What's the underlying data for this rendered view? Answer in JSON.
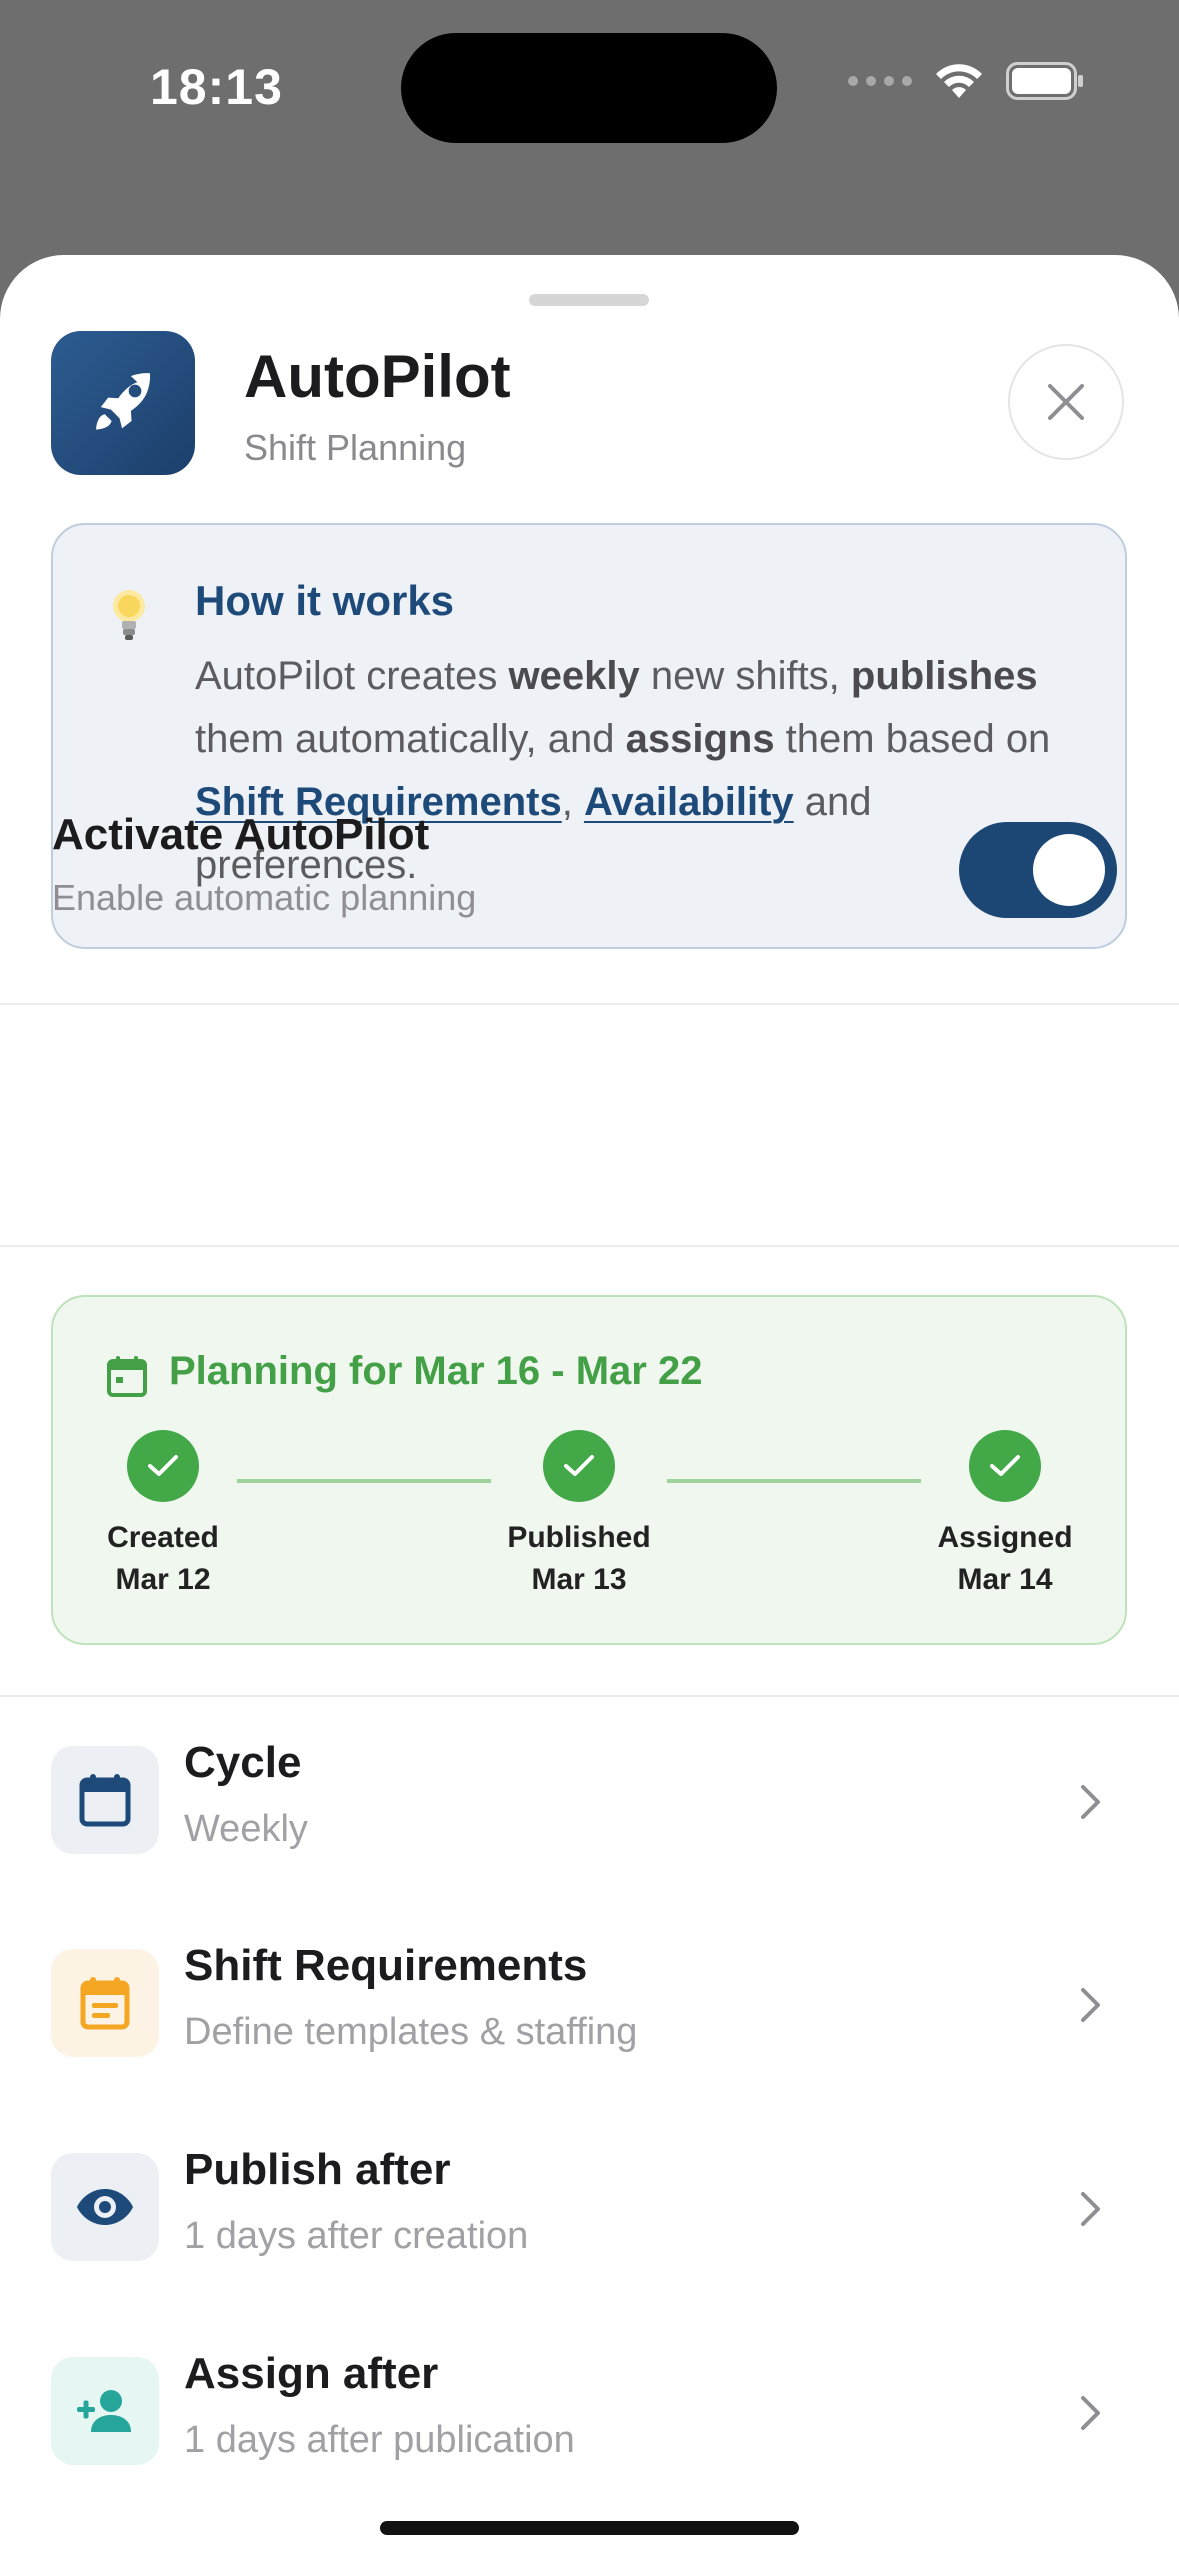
{
  "status_bar": {
    "time": "18:13"
  },
  "sheet": {
    "app": {
      "title": "AutoPilot",
      "subtitle": "Shift Planning",
      "icon": "rocket-icon"
    },
    "info": {
      "title": "How it works",
      "text_1": "AutoPilot creates ",
      "bold_1": "weekly",
      "text_2": " new shifts, ",
      "bold_2": "publishes",
      "text_3": " them automatically, and ",
      "bold_3": "assigns",
      "text_4": " them based on ",
      "link_1": "Shift Requirements",
      "text_5": ", ",
      "link_2": "Availability",
      "text_6": " and preferences."
    },
    "activate": {
      "title": "Activate AutoPilot",
      "subtitle": "Enable automatic planning",
      "enabled": true
    },
    "planning": {
      "title": "Planning for Mar 16 - Mar 22",
      "steps": [
        {
          "label": "Created",
          "date": "Mar 12",
          "done": true
        },
        {
          "label": "Published",
          "date": "Mar 13",
          "done": true
        },
        {
          "label": "Assigned",
          "date": "Mar 14",
          "done": true
        }
      ]
    },
    "settings": [
      {
        "title": "Cycle",
        "subtitle": "Weekly",
        "icon": "calendar-icon",
        "color": "#1e4a7a"
      },
      {
        "title": "Shift Requirements",
        "subtitle": "Define templates & staffing",
        "icon": "calendar-list-icon",
        "color": "#f5a623"
      },
      {
        "title": "Publish after",
        "subtitle": "1 days after creation",
        "icon": "eye-icon",
        "color": "#1e4a7a"
      },
      {
        "title": "Assign after",
        "subtitle": "1 days after publication",
        "icon": "person-add-icon",
        "color": "#26a69a"
      }
    ]
  },
  "colors": {
    "accent": "#1c4775",
    "success": "#43a847",
    "link": "#1e4a7a"
  }
}
